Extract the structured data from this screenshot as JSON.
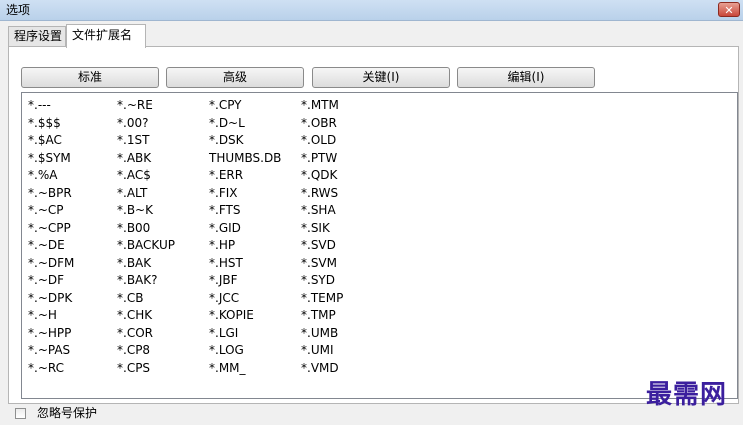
{
  "window": {
    "title": "选项",
    "close_glyph": "✕"
  },
  "tabs": [
    {
      "label": "程序设置",
      "active": false
    },
    {
      "label": "文件扩展名",
      "active": true
    }
  ],
  "buttons": {
    "standard": "标准",
    "advanced": "高级",
    "keys": "关键(I)",
    "edit": "编辑(I)"
  },
  "extensions": [
    "*.---",
    "*.$$$",
    "*.$AC",
    "*.$SYM",
    "*.%A",
    "*.~BPR",
    "*.~CP",
    "*.~CPP",
    "*.~DE",
    "*.~DFM",
    "*.~DF",
    "*.~DPK",
    "*.~H",
    "*.~HPP",
    "*.~PAS",
    "*.~RC",
    "*.~RE",
    "*.00?",
    "*.1ST",
    "*.ABK",
    "*.AC$",
    "*.ALT",
    "*.B~K",
    "*.B00",
    "*.BACKUP",
    "*.BAK",
    "*.BAK?",
    "*.CB",
    "*.CHK",
    "*.COR",
    "*.CP8",
    "*.CPS",
    "*.CPY",
    "*.D~L",
    "*.DSK",
    "THUMBS.DB",
    "*.ERR",
    "*.FIX",
    "*.FTS",
    "*.GID",
    "*.HP",
    "*.HST",
    "*.JBF",
    "*.JCC",
    "*.KOPIE",
    "*.LGI",
    "*.LOG",
    "*.MM_",
    "*.MTM",
    "*.OBR",
    "*.OLD",
    "*.PTW",
    "*.QDK",
    "*.RWS",
    "*.SHA",
    "*.SIK",
    "*.SVD",
    "*.SVM",
    "*.SYD",
    "*.TEMP",
    "*.TMP",
    "*.UMB",
    "*.UMI",
    "*.VMD"
  ],
  "checkbox": {
    "label": "忽略号保护",
    "checked": false
  },
  "watermark": "最需网"
}
